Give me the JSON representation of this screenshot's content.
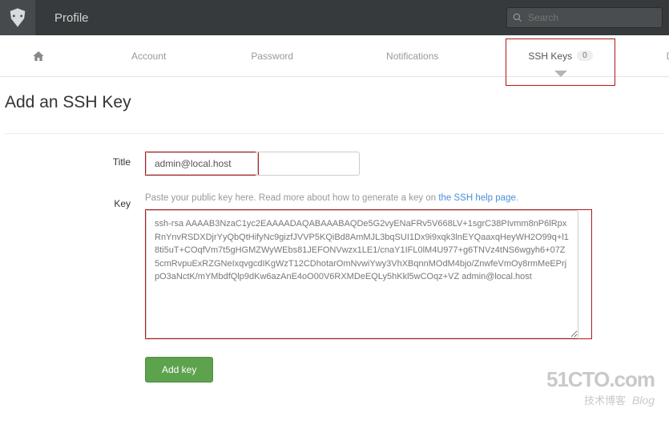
{
  "header": {
    "title": "Profile",
    "search_placeholder": "Search"
  },
  "tabs": {
    "account": "Account",
    "password": "Password",
    "notifications": "Notifications",
    "ssh_keys": "SSH Keys",
    "ssh_keys_count": "0",
    "design": "Design"
  },
  "page": {
    "heading": "Add an SSH Key"
  },
  "form": {
    "title_label": "Title",
    "title_value": "admin@local.host",
    "key_label": "Key",
    "key_help_prefix": "Paste your public key here. Read more about how to generate a key on ",
    "key_help_link": "the SSH help page",
    "key_help_suffix": ".",
    "key_value": "ssh-rsa AAAAB3NzaC1yc2EAAAADAQABAAABAQDe5G2vyENaFRv5V668LV+1sgrC38PIvmm8nP6lRpxRnYnvRSDXDjrYyQbQtHifyNc9gizfJVVP5KQiBd8AmMJL3bqSUI1Dx9i9xqk3lnEYQaaxqHeyWH2O99q+l18ti5uT+COqfVm7t5gHGMZWyWEbs81JEFONVwzx1LE1/cnaY1IFL0lM4U977+g6TNVz4tNS6wgyh6+07Z5cmRvpuExRZGNeIxqvgcdIKgWzT12CDhotarOmNvwiYwy3VhXBqnnMOdM4bjo/ZnwfeVmOy8rmMeEPrjpO3aNctK/mYMbdfQlp9dKw6azAnE4oO00V6RXMDeEQLy5hKkl5wCOqz+VZ admin@local.host",
    "submit_label": "Add key"
  },
  "watermark": {
    "main": "51CTO.com",
    "sub_cn": "技术博客",
    "sub_en": "Blog"
  }
}
